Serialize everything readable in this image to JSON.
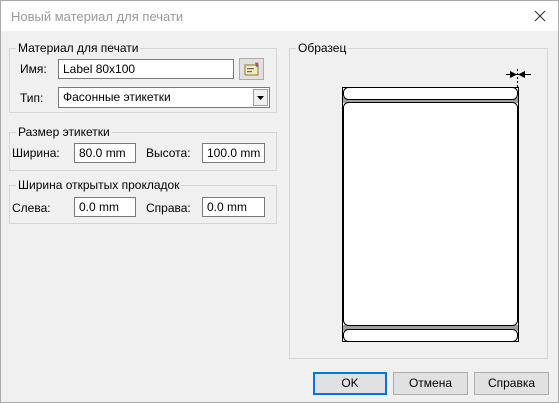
{
  "window": {
    "title": "Новый материал для печати"
  },
  "material_group": {
    "legend": "Материал для печати",
    "name_label": "Имя:",
    "name_value": "Label 80x100",
    "type_label": "Тип:",
    "type_value": "Фасонные этикетки"
  },
  "size_group": {
    "legend": "Размер этикетки",
    "width_label": "Ширина:",
    "width_value": "80.0 mm",
    "height_label": "Высота:",
    "height_value": "100.0 mm"
  },
  "liner_group": {
    "legend": "Ширина открытых прокладок",
    "left_label": "Слева:",
    "left_value": "0.0 mm",
    "right_label": "Справа:",
    "right_value": "0.0 mm"
  },
  "sample_group": {
    "legend": "Образец"
  },
  "buttons": {
    "ok": "OK",
    "cancel": "Отмена",
    "help": "Справка"
  },
  "colors": {
    "accent": "#0078d7",
    "liner": "#a0a0a0"
  }
}
